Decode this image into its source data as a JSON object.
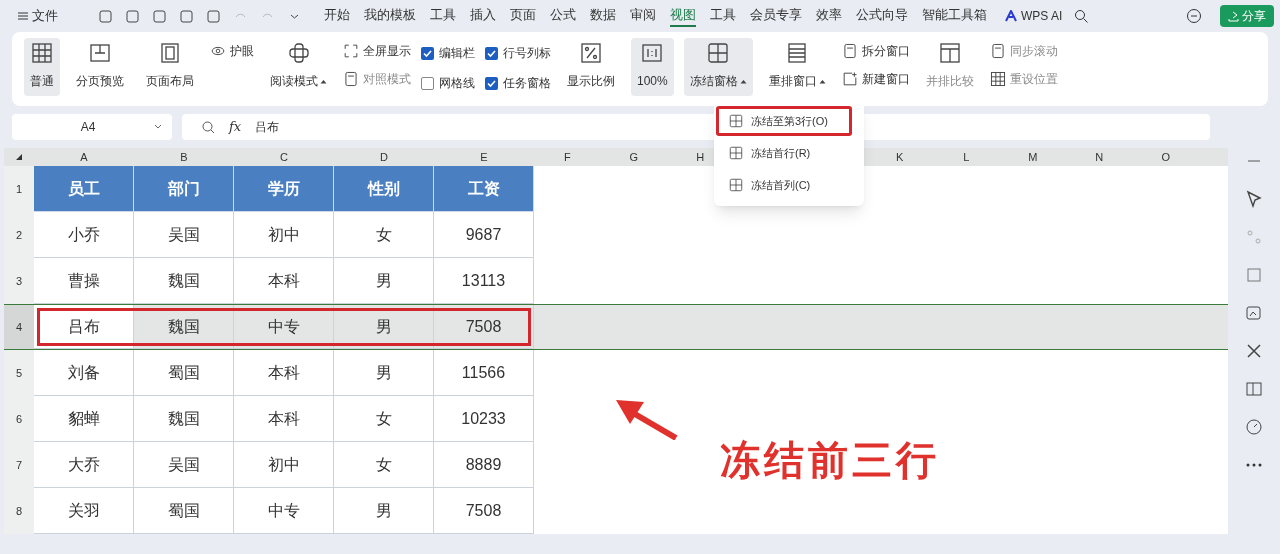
{
  "title_bar": {
    "menu_label": "文件",
    "tabs": [
      {
        "label": "开始",
        "selected": false
      },
      {
        "label": "我的模板",
        "selected": false
      },
      {
        "label": "工具",
        "selected": false
      },
      {
        "label": "插入",
        "selected": false
      },
      {
        "label": "页面",
        "selected": false
      },
      {
        "label": "公式",
        "selected": false
      },
      {
        "label": "数据",
        "selected": false
      },
      {
        "label": "审阅",
        "selected": false
      },
      {
        "label": "视图",
        "selected": true
      },
      {
        "label": "工具",
        "selected": false
      },
      {
        "label": "会员专享",
        "selected": false
      },
      {
        "label": "效率",
        "selected": false
      },
      {
        "label": "公式向导",
        "selected": false
      },
      {
        "label": "智能工具箱",
        "selected": false
      }
    ],
    "ai_label": "WPS AI",
    "share_button": "分享"
  },
  "ribbon": [
    {
      "kind": "large",
      "label": "普通",
      "selected": true
    },
    {
      "kind": "large",
      "label": "分页预览",
      "selected": false
    },
    {
      "kind": "large",
      "label": "页面布局",
      "selected": false
    },
    {
      "kind": "stack",
      "items": [
        {
          "label": "护眼",
          "disabled": false
        }
      ]
    },
    {
      "kind": "large",
      "label": "阅读模式",
      "dropdown": true,
      "selected": false
    },
    {
      "kind": "stack",
      "items": [
        {
          "label": "全屏显示",
          "disabled": false
        },
        {
          "label": "对照模式",
          "disabled": true
        }
      ]
    },
    {
      "kind": "checks",
      "items": [
        {
          "label": "编辑栏",
          "checked": true
        },
        {
          "label": "网格线",
          "checked": false
        }
      ]
    },
    {
      "kind": "checks",
      "items": [
        {
          "label": "行号列标",
          "checked": true
        },
        {
          "label": "任务窗格",
          "checked": true
        }
      ]
    },
    {
      "kind": "large",
      "label": "显示比例",
      "selected": false
    },
    {
      "kind": "large",
      "label": "100%",
      "selected": true
    },
    {
      "kind": "large",
      "label": "冻结窗格",
      "dropdown": true,
      "selected": true
    },
    {
      "kind": "large",
      "label": "重排窗口",
      "dropdown": true,
      "selected": false
    },
    {
      "kind": "stack",
      "items": [
        {
          "label": "拆分窗口",
          "disabled": false
        },
        {
          "label": "新建窗口",
          "disabled": false
        }
      ]
    },
    {
      "kind": "large",
      "label": "并排比较",
      "disabled": true,
      "selected": false
    },
    {
      "kind": "stack",
      "items": [
        {
          "label": "同步滚动",
          "disabled": true
        },
        {
          "label": "重设位置",
          "disabled": true
        }
      ]
    }
  ],
  "freeze_menu": [
    {
      "label": "冻结至第3行(O)",
      "selected": true
    },
    {
      "label": "冻结首行(R)",
      "selected": false
    },
    {
      "label": "冻结首列(C)",
      "selected": false
    }
  ],
  "formula_bar": {
    "name_box": "A4",
    "fx_label": "fx",
    "formula": "吕布"
  },
  "sheet": {
    "columns_left": [
      "A",
      "B",
      "C",
      "D",
      "E",
      "F",
      "G",
      "H"
    ],
    "columns_right": [
      "K",
      "L",
      "M",
      "N",
      "O"
    ],
    "rows": [
      {
        "number": "1",
        "header": true,
        "selected": false,
        "cells": [
          "员工",
          "部门",
          "学历",
          "性别",
          "工资"
        ]
      },
      {
        "number": "2",
        "header": false,
        "selected": false,
        "cells": [
          "小乔",
          "吴国",
          "初中",
          "女",
          "9687"
        ]
      },
      {
        "number": "3",
        "header": false,
        "selected": false,
        "cells": [
          "曹操",
          "魏国",
          "本科",
          "男",
          "13113"
        ]
      },
      {
        "number": "4",
        "header": false,
        "selected": true,
        "cells": [
          "吕布",
          "魏国",
          "中专",
          "男",
          "7508"
        ]
      },
      {
        "number": "5",
        "header": false,
        "selected": false,
        "cells": [
          "刘备",
          "蜀国",
          "本科",
          "男",
          "11566"
        ]
      },
      {
        "number": "6",
        "header": false,
        "selected": false,
        "cells": [
          "貂蝉",
          "魏国",
          "本科",
          "女",
          "10233"
        ]
      },
      {
        "number": "7",
        "header": false,
        "selected": false,
        "cells": [
          "大乔",
          "吴国",
          "初中",
          "女",
          "8889"
        ]
      },
      {
        "number": "8",
        "header": false,
        "selected": false,
        "cells": [
          "关羽",
          "蜀国",
          "中专",
          "男",
          "7508"
        ]
      }
    ]
  },
  "annotation": "冻结前三行"
}
